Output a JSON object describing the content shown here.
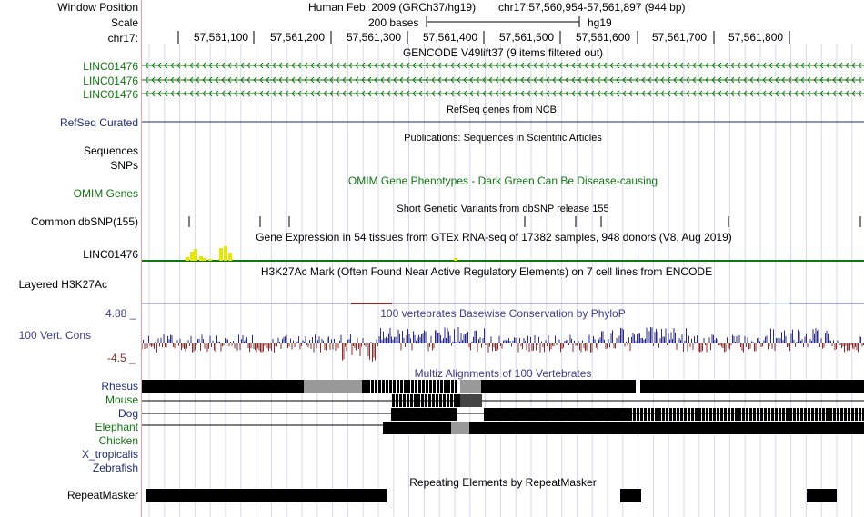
{
  "labels": {
    "window_position": "Window Position",
    "scale": "Scale",
    "chrom": "chr17:",
    "gencode_1": "LINC01476",
    "gencode_2": "LINC01476",
    "gencode_3": "LINC01476",
    "refseq": "RefSeq Curated",
    "sequences": "Sequences",
    "snps": "SNPs",
    "omim": "OMIM Genes",
    "dbsnp": "Common dbSNP(155)",
    "gtex": "LINC01476",
    "h3k27ac": "Layered H3K27Ac",
    "cons_max": "4.88 _",
    "cons": "100 Vert. Cons",
    "cons_min": "-4.5 _",
    "species": [
      "Rhesus",
      "Mouse",
      "Dog",
      "Elephant",
      "Chicken",
      "X_tropicalis",
      "Zebrafish"
    ],
    "repeatmasker": "RepeatMasker"
  },
  "header": {
    "assembly": "Human Feb. 2009 (GRCh37/hg19)",
    "position": "chr17:57,560,954-57,561,897 (944 bp)",
    "scale_text": "200 bases",
    "scale_db": "hg19",
    "positions": [
      "57,561,100",
      "57,561,200",
      "57,561,300",
      "57,561,400",
      "57,561,500",
      "57,561,600",
      "57,561,700",
      "57,561,800"
    ]
  },
  "tracks": {
    "gencode_title": "GENCODE V49lift37 (9 items filtered out)",
    "refseq_title": "RefSeq genes from NCBI",
    "pubs_title": "Publications: Sequences in Scientific Articles",
    "omim_title": "OMIM Gene Phenotypes - Dark Green Can Be Disease-causing",
    "dbsnp_title": "Short Genetic Variants from dbSNP release 155",
    "gtex_title": "Gene Expression in 54 tissues from GTEx RNA-seq of 17382 samples, 948 donors (V8, Aug 2019)",
    "h3k27ac_title": "H3K27Ac Mark (Often Found Near Active Regulatory Elements) on 7 cell lines from ENCODE",
    "cons_title": "100 vertebrates Basewise Conservation by PhyloP",
    "multiz_title": "Multiz Alignments of 100 Vertebrates",
    "rmsk_title": "Repeating Elements by RepeatMasker"
  },
  "colors": {
    "gencode": "#117711",
    "refseq": "#1f2d7a",
    "cons_pos": "#2b2b8a",
    "cons_neg": "#8b2b2b",
    "gtex_bar": "#e6e600",
    "grid": "#d8d8ee",
    "divider": "#f2a0a0"
  }
}
